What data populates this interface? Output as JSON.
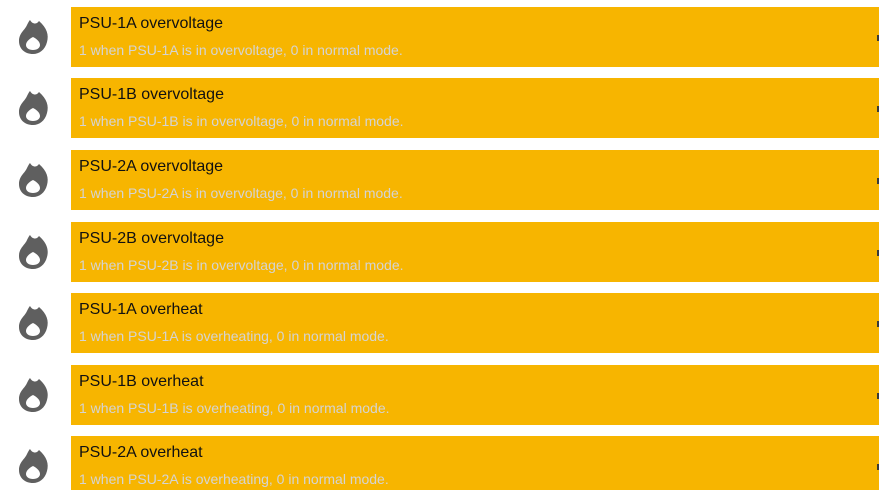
{
  "colors": {
    "card_background": "#f7b500",
    "title_text": "#111111",
    "subtitle_text": "#d4d4d4",
    "icon": "#5f5f5f"
  },
  "items": [
    {
      "icon": "flame-icon",
      "title": "PSU-1A overvoltage",
      "subtitle": "1 when PSU-1A is in overvoltage, 0 in normal mode."
    },
    {
      "icon": "flame-icon",
      "title": "PSU-1B overvoltage",
      "subtitle": "1 when PSU-1B is in overvoltage, 0 in normal mode."
    },
    {
      "icon": "flame-icon",
      "title": "PSU-2A overvoltage",
      "subtitle": "1 when PSU-2A is in overvoltage, 0 in normal mode."
    },
    {
      "icon": "flame-icon",
      "title": "PSU-2B overvoltage",
      "subtitle": "1 when PSU-2B is in overvoltage, 0 in normal mode."
    },
    {
      "icon": "flame-icon",
      "title": "PSU-1A overheat",
      "subtitle": "1 when PSU-1A is overheating, 0 in normal mode."
    },
    {
      "icon": "flame-icon",
      "title": "PSU-1B overheat",
      "subtitle": "1 when PSU-1B is overheating, 0 in normal mode."
    },
    {
      "icon": "flame-icon",
      "title": "PSU-2A overheat",
      "subtitle": "1 when PSU-2A is overheating, 0 in normal mode."
    }
  ]
}
